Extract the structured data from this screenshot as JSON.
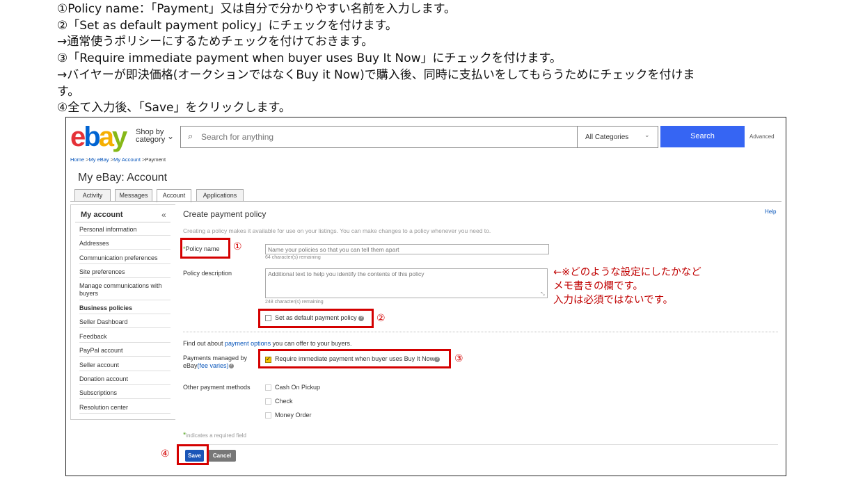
{
  "instructions": [
    "①Policy name：「Payment」又は自分で分かりやすい名前を入力します。",
    "②「Set as default payment policy」にチェックを付けます。",
    "→通常使うポリシーにするためチェックを付けておきます。",
    "③「Require immediate payment when buyer uses Buy It Now」にチェックを付けます。",
    "→バイヤーが即決価格(オークションではなくBuy it Now)で購入後、同時に支払いをしてもらうためにチェックを付けま",
    "す。",
    "④全て入力後、「Save」をクリックします。"
  ],
  "header": {
    "logo_letters": [
      "e",
      "b",
      "a",
      "y"
    ],
    "shop_by_line1": "Shop by",
    "shop_by_line2": "category",
    "search_placeholder": "Search for anything",
    "category_select": "All Categories",
    "search_button": "Search",
    "advanced_link": "Advanced"
  },
  "breadcrumb": {
    "home": "Home",
    "my_ebay": "My eBay",
    "my_account": "My Account",
    "payment": "Payment"
  },
  "page_title": "My eBay: Account",
  "tabs": [
    {
      "label": "Activity"
    },
    {
      "label": "Messages"
    },
    {
      "label": "Account"
    },
    {
      "label": "Applications"
    }
  ],
  "sidebar": {
    "heading": "My account",
    "collapse": "«",
    "items": [
      "Personal information",
      "Addresses",
      "Communication preferences",
      "Site preferences",
      "Manage communications with buyers",
      "Business policies",
      "Seller Dashboard",
      "Feedback",
      "PayPal account",
      "Seller account",
      "Donation account",
      "Subscriptions",
      "Resolution center"
    ]
  },
  "form": {
    "heading": "Create payment policy",
    "help": "Help",
    "intro": "Creating a policy makes it available for use on your listings. You can make changes to a policy whenever you need to.",
    "required_star": "*",
    "policy_name_label": "Policy name",
    "policy_name_placeholder": "Name your policies so that you can tell them apart",
    "policy_name_remaining": "64 character(s) remaining",
    "description_label": "Policy description",
    "description_placeholder": "Additional text to help you identify the contents of this policy",
    "description_remaining": "248 character(s) remaining",
    "default_policy_label": "Set as default payment policy",
    "find_out_prefix": "Find out about ",
    "payment_options_link": "payment options",
    "find_out_suffix": " you can offer to your buyers.",
    "managed_label_1": "Payments managed by",
    "managed_label_2": "eBay",
    "fee_varies": "(fee varies)",
    "immediate_payment_label": "Require immediate payment when buyer uses Buy It Now",
    "other_methods_label": "Other payment methods",
    "other_methods": [
      "Cash On Pickup",
      "Check",
      "Money Order"
    ],
    "required_note": "indicates a required field",
    "save_button": "Save",
    "cancel_button": "Cancel"
  },
  "annotations": {
    "num1": "①",
    "num2": "②",
    "num3": "③",
    "num4": "④",
    "note_line1": "←※どのような設定にしたかなど",
    "note_line2": "メモ書きの欄です。",
    "note_line3": "入力は必須ではないです。"
  },
  "colors": {
    "annotation_red": "#d40000",
    "search_blue": "#3665f3",
    "save_blue": "#1a56b8",
    "cancel_gray": "#777777",
    "link_blue": "#0654ba"
  }
}
